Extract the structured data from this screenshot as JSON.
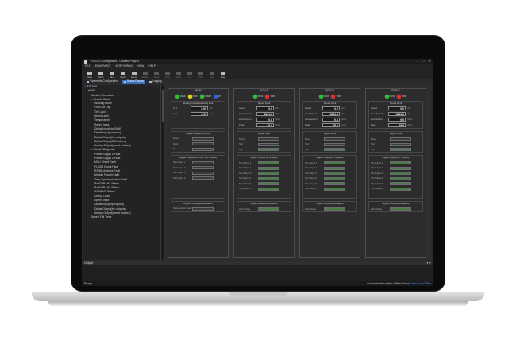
{
  "app": {
    "title": "FSCIOS Configurator - Untitled Project",
    "window_controls": [
      "–",
      "□",
      "✕"
    ]
  },
  "menu": [
    "FILE",
    "EQUIPMENT",
    "MONITORING",
    "VIEW",
    "HELP"
  ],
  "toolbar": [
    {
      "label": "New",
      "icon": "new-file-icon",
      "enabled": true
    },
    {
      "label": "Open",
      "icon": "open-folder-icon",
      "enabled": true
    },
    {
      "label": "Save",
      "icon": "save-icon",
      "enabled": true
    },
    {
      "label": "Import",
      "icon": "import-icon",
      "enabled": true
    },
    {
      "label": "Export",
      "icon": "export-icon",
      "enabled": true
    },
    {
      "label": "Validate",
      "icon": "check-icon",
      "enabled": false
    },
    {
      "label": "Read",
      "icon": "read-icon",
      "enabled": false
    },
    {
      "label": "Write",
      "icon": "write-icon",
      "enabled": false
    },
    {
      "label": "Verify",
      "icon": "verify-icon",
      "enabled": false
    },
    {
      "label": "Log",
      "icon": "log-icon",
      "enabled": false
    },
    {
      "label": "Start",
      "icon": "start-icon",
      "enabled": false
    },
    {
      "label": "Stop",
      "icon": "stop-icon",
      "enabled": false
    },
    {
      "label": "Help",
      "icon": "help-icon",
      "enabled": true
    }
  ],
  "tabs": [
    {
      "label": "Parameter Configuration",
      "active": false
    },
    {
      "label": "Status Display",
      "active": true
    },
    {
      "label": "Logging",
      "active": false
    }
  ],
  "tree": [
    {
      "label": "▸ FSCIOS",
      "indent": 0
    },
    {
      "label": "▾ SIM",
      "indent": 1
    },
    {
      "label": "Module Information",
      "indent": 2
    },
    {
      "label": "▾ Module Status",
      "indent": 2
    },
    {
      "label": "Working Mode",
      "indent": 3
    },
    {
      "label": "First Out Trip",
      "indent": 3
    },
    {
      "label": "Trip Latch",
      "indent": 3
    },
    {
      "label": "Alarm Latch",
      "indent": 3
    },
    {
      "label": "Temperature",
      "indent": 3
    },
    {
      "label": "Speed Input",
      "indent": 3
    },
    {
      "label": "Digital Input(trip SOM)",
      "indent": 3
    },
    {
      "label": "Digital Input(common)",
      "indent": 3
    },
    {
      "label": "Digital Output(trip outputs)",
      "indent": 3
    },
    {
      "label": "Digital Output(SOM alarm)",
      "indent": 3
    },
    {
      "label": "Analog Output(speed readout)",
      "indent": 3
    },
    {
      "label": "▾ Module Diagnosis",
      "indent": 2
    },
    {
      "label": "Power Supply 1 Fault",
      "indent": 3
    },
    {
      "label": "Power Supply 2 Fault",
      "indent": 3
    },
    {
      "label": "MCU Check Fault",
      "indent": 3
    },
    {
      "label": "FLASH Check Fault",
      "indent": 3
    },
    {
      "label": "RS485 Address Fault",
      "indent": 3
    },
    {
      "label": "Module Plug-in Fault",
      "indent": 3
    },
    {
      "label": "Time Synchronization Fault",
      "indent": 3
    },
    {
      "label": "PortDPRAM1 Status",
      "indent": 3
    },
    {
      "label": "PortDPRAM2 Status",
      "indent": 3
    },
    {
      "label": "COMBUS Status",
      "indent": 3
    },
    {
      "label": "Debug Code",
      "indent": 3
    },
    {
      "label": "Speed Input",
      "indent": 3
    },
    {
      "label": "Digital Input(trip outputs)",
      "indent": 3
    },
    {
      "label": "Digital Output(trip outputs)",
      "indent": 3
    },
    {
      "label": "Analog Output(speed readout)",
      "indent": 3
    },
    {
      "label": "Speed Fail Timer",
      "indent": 2
    }
  ],
  "panels": [
    {
      "title": "MCM",
      "leds": [
        {
          "label": "PASS",
          "color": "#2fbf3a"
        },
        {
          "label": "TRIP",
          "color": "#e8d42a"
        },
        {
          "label": "COMM",
          "color": "#2fbf3a"
        },
        {
          "label": "RT",
          "color": "#2f63d8"
        }
      ],
      "top_section": {
        "title": "Analog Inputs/Selectivity look",
        "rows": [
          {
            "label": "AI 1",
            "value": "0.00",
            "unit": "mA"
          },
          {
            "label": "AI 2",
            "value": "0.00",
            "unit": "mA"
          }
        ]
      },
      "mid_section": {
        "title": "Digital Inputs(common)",
        "rows": [
          {
            "label": "Reset",
            "state": "off"
          },
          {
            "label": "Reg1",
            "state": "off"
          },
          {
            "label": "Tst",
            "state": "off"
          }
        ]
      },
      "out_section": {
        "title": "Digital Outputs(common Set outputs)",
        "rows": [
          "Test Output 1",
          "Test Output 2",
          "Test Output 3",
          "Test Output 4"
        ]
      },
      "alarm_section": {
        "title": "Digital Output(system alarm)",
        "rows": [
          "System Alarm Relay"
        ]
      }
    },
    {
      "title": "SOM A",
      "leds": [
        {
          "label": "PASS",
          "color": "#2fbf3a"
        },
        {
          "label": "TRIP",
          "color": "#e23232"
        }
      ],
      "top_section": {
        "title": "Speed Input",
        "rows": [
          {
            "label": "Speed",
            "value": "0.0",
            "unit": "rpm"
          },
          {
            "label": "Peak Speed",
            "value": "3241.0",
            "unit": "rpm"
          },
          {
            "label": "Acceleration",
            "value": "0.0",
            "unit": "rpm/s"
          },
          {
            "label": "Peak",
            "value": "48.0",
            "unit": "rpm/s"
          }
        ]
      },
      "mid_section": {
        "title": "Digital Input",
        "rows": [
          {
            "label": "Reset",
            "state": "off"
          },
          {
            "label": "Test",
            "state": "off"
          },
          {
            "label": "Trip",
            "state": "on"
          }
        ]
      },
      "out_section": {
        "title": "Digital Output(trip outputs)",
        "rows": [
          "Trip Output 1",
          "Trip Output 2",
          "Trip Output 3",
          "Trip Output 4",
          "Trip Output 5",
          "Trip Output 6"
        ]
      },
      "alarm_section": {
        "title": "Digital Output(SOM alarm)",
        "rows": [
          "Alarm Relay"
        ]
      }
    },
    {
      "title": "SOM B",
      "leds": [
        {
          "label": "PASS",
          "color": "#2fbf3a"
        },
        {
          "label": "TRIP",
          "color": "#e23232"
        }
      ],
      "top_section": {
        "title": "Speed Input",
        "rows": [
          {
            "label": "Speed",
            "value": "0.0",
            "unit": "rpm"
          },
          {
            "label": "Peak Speed",
            "value": "3241.0",
            "unit": "rpm"
          },
          {
            "label": "Acceleration",
            "value": "0.0",
            "unit": "rpm/s"
          },
          {
            "label": "Peak",
            "value": "48.0",
            "unit": "rpm/s"
          }
        ]
      },
      "mid_section": {
        "title": "Digital Input",
        "rows": [
          {
            "label": "Reset",
            "state": "off"
          },
          {
            "label": "Test",
            "state": "off"
          },
          {
            "label": "Trip",
            "state": "on"
          }
        ]
      },
      "out_section": {
        "title": "Digital Output(trip outputs)",
        "rows": [
          "Trip Output 1",
          "Trip Output 2",
          "Trip Output 3",
          "Trip Output 4",
          "Trip Output 5",
          "Trip Output 6"
        ]
      },
      "alarm_section": {
        "title": "Digital Output(SOM alarm)",
        "rows": [
          "Alarm Relay"
        ]
      }
    },
    {
      "title": "SOM C",
      "leds": [
        {
          "label": "PASS",
          "color": "#2fbf3a"
        },
        {
          "label": "TRIP",
          "color": "#e23232"
        }
      ],
      "top_section": {
        "title": "Speed Input",
        "rows": [
          {
            "label": "Speed",
            "value": "0.0",
            "unit": "rpm"
          },
          {
            "label": "Peak Speed",
            "value": "3241.0",
            "unit": "rpm"
          },
          {
            "label": "Acceleration",
            "value": "0.0",
            "unit": "rpm/s"
          },
          {
            "label": "Peak",
            "value": "48.0",
            "unit": "rpm/s"
          }
        ]
      },
      "mid_section": {
        "title": "Digital Input",
        "rows": [
          {
            "label": "Reset",
            "state": "off"
          },
          {
            "label": "Test",
            "state": "off"
          },
          {
            "label": "Trip",
            "state": "on"
          }
        ]
      },
      "out_section": {
        "title": "Digital Output(trip outputs)",
        "rows": [
          "Trip Output 1",
          "Trip Output 2",
          "Trip Output 3",
          "Trip Output 4",
          "Trip Output 5",
          "Trip Output 6"
        ]
      },
      "alarm_section": {
        "title": "Digital Output(SOM alarm)",
        "rows": [
          "Alarm Relay"
        ]
      }
    }
  ],
  "output": {
    "title": "Output",
    "controls": "▾ ✕"
  },
  "status": {
    "left": "Ready",
    "right": "Communication status:Offline Status",
    "link": "Save Local Offline"
  }
}
